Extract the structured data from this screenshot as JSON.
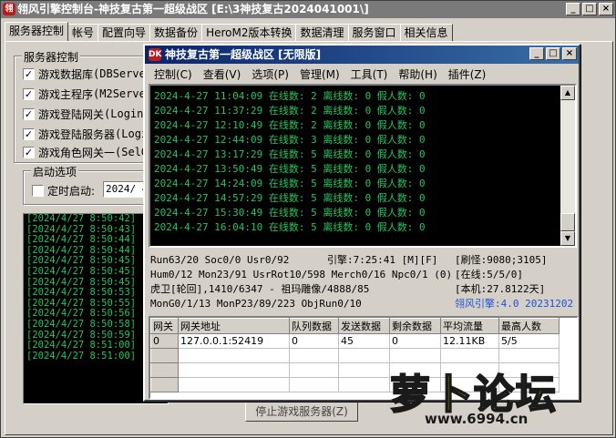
{
  "back_window": {
    "title": "翎风引擎控制台-神技复古第一超级战区 [E:\\3神技复古2024041001\\]",
    "icon_text": "翎",
    "controls": [
      "_",
      "□",
      "×"
    ],
    "tabs": [
      "服务器控制",
      "帐号",
      "配置向导",
      "数据备份",
      "HeroM2版本转换",
      "数据清理",
      "服务窗口",
      "相关信息"
    ],
    "server_group": {
      "label": "服务器控制",
      "items": [
        {
          "label": "游戏数据库",
          "suffix": "(DBServer"
        },
        {
          "label": "游戏主程序",
          "suffix": "(M2Server"
        },
        {
          "label": "游戏登陆网关",
          "suffix": "(LoginG"
        },
        {
          "label": "游戏登陆服务器",
          "suffix": "(Logi"
        },
        {
          "label": "游戏角色网关一",
          "suffix": "(SelG"
        }
      ]
    },
    "startup_group": {
      "label": "启动选项",
      "timed_start_label": "定时启动:",
      "timed_start_value": "2024/ 4"
    },
    "log_lines": [
      "[2024/4/27 8:50:42]",
      "[2024/4/27 8:50:43]",
      "[2024/4/27 8:50:44]",
      "[2024/4/27 8:50:44]",
      "[2024/4/27 8:50:45]",
      "[2024/4/27 8:50:45]",
      "[2024/4/27 8:50:45]",
      "[2024/4/27 8:50:53]",
      "[2024/4/27 8:50:55]",
      "[2024/4/27 8:50:56]",
      "[2024/4/27 8:50:58]",
      "[2024/4/27 8:50:59]",
      "[2024/4/27 8:51:00]",
      "[2024/4/27 8:51:00]"
    ],
    "stop_button": "停止游戏服务器(Z)"
  },
  "front_window": {
    "title": "神技复古第一超级战区 [无限版]",
    "icon_text": "DK",
    "menu": [
      "控制(C)",
      "查看(V)",
      "选项(P)",
      "管理(M)",
      "工具(T)",
      "帮助(H)",
      "插件(Z)"
    ],
    "console_lines": [
      "2024-4-27 11:04:09 在线数: 2 离线数: 0 假人数: 0",
      "2024-4-27 11:37:29 在线数: 2 离线数: 0 假人数: 0",
      "2024-4-27 12:10:49 在线数: 2 离线数: 0 假人数: 0",
      "2024-4-27 12:44:09 在线数: 3 离线数: 0 假人数: 0",
      "2024-4-27 13:17:29 在线数: 5 离线数: 0 假人数: 0",
      "2024-4-27 13:50:49 在线数: 5 离线数: 0 假人数: 0",
      "2024-4-27 14:24:09 在线数: 5 离线数: 0 假人数: 0",
      "2024-4-27 14:57:29 在线数: 5 离线数: 0 假人数: 0",
      "2024-4-27 15:30:49 在线数: 5 离线数: 0 假人数: 0",
      "2024-4-27 16:04:10 在线数: 5 离线数: 0 假人数: 0"
    ],
    "status_left": [
      "Run63/20 Soc0/0 Usr0/92",
      "Hum0/12 Mon23/91 UsrRot10/598 Merch0/16 Npc0/1 (0)",
      "虎卫[轮回],1410/6347 - 祖玛雕像/4888/85",
      "MonG0/1/13 MonP23/89/223 ObjRun0/10"
    ],
    "engine_time": "引擎:7:25:41 [M][F]",
    "status_right": [
      "[刷怪:9080;3105]",
      "[在线:5/5/0]",
      "[本机:27.8122天]",
      "翎风引擎:4.0 20231202"
    ],
    "version_color": "#1f4fd8",
    "gateway_table": {
      "headers": [
        "网关",
        "网关地址",
        "队列数据",
        "发送数据",
        "剩余数据",
        "平均流量",
        "最高人数"
      ],
      "rows": [
        [
          "0",
          "127.0.0.1:52419",
          "0",
          "45",
          "0",
          "12.11KB",
          "5/5"
        ]
      ]
    }
  },
  "watermark": {
    "text": "萝卜论坛",
    "url": "www.6994.cn"
  }
}
